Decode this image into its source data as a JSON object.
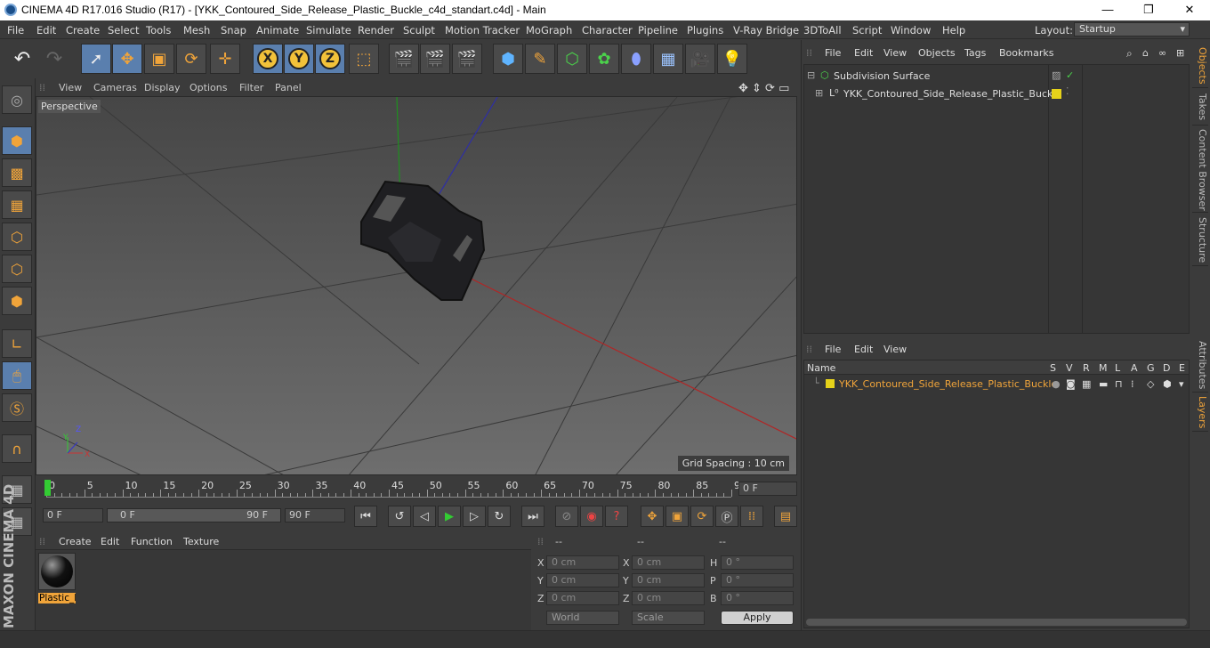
{
  "window": {
    "title": "CINEMA 4D R17.016 Studio (R17) - [YKK_Contoured_Side_Release_Plastic_Buckle_c4d_standart.c4d] - Main",
    "minimize": "—",
    "maximize": "❐",
    "close": "✕"
  },
  "menu": [
    "File",
    "Edit",
    "Create",
    "Select",
    "Tools",
    "Mesh",
    "Snap",
    "Animate",
    "Simulate",
    "Render",
    "Sculpt",
    "Motion Tracker",
    "MoGraph",
    "Character",
    "Pipeline",
    "Plugins",
    "V-Ray Bridge",
    "3DToAll",
    "Script",
    "Window",
    "Help"
  ],
  "layout": {
    "label": "Layout:",
    "value": "Startup"
  },
  "viewport": {
    "menu": [
      "View",
      "Cameras",
      "Display",
      "Options",
      "Filter",
      "Panel"
    ],
    "camera": "Perspective",
    "grid_spacing": "Grid Spacing : 10 cm"
  },
  "timeline": {
    "ticks": [
      "0",
      "5",
      "10",
      "15",
      "20",
      "25",
      "30",
      "35",
      "40",
      "45",
      "50",
      "55",
      "60",
      "65",
      "70",
      "75",
      "80",
      "85",
      "90"
    ],
    "current_frame": "0 F",
    "start": "0 F",
    "range_start": "0 F",
    "range_end": "90 F",
    "end": "90 F"
  },
  "material": {
    "menu": [
      "Create",
      "Edit",
      "Function",
      "Texture"
    ],
    "name": "Plastic_E"
  },
  "coords": {
    "header": [
      "--",
      "--",
      "--"
    ],
    "pos": [
      {
        "l": "X",
        "v": "0 cm"
      },
      {
        "l": "Y",
        "v": "0 cm"
      },
      {
        "l": "Z",
        "v": "0 cm"
      }
    ],
    "size": [
      {
        "l": "X",
        "v": "0 cm"
      },
      {
        "l": "Y",
        "v": "0 cm"
      },
      {
        "l": "Z",
        "v": "0 cm"
      }
    ],
    "rot": [
      {
        "l": "H",
        "v": "0 °"
      },
      {
        "l": "P",
        "v": "0 °"
      },
      {
        "l": "B",
        "v": "0 °"
      }
    ],
    "world": "World",
    "scale": "Scale",
    "apply": "Apply"
  },
  "objects": {
    "menu": [
      "File",
      "Edit",
      "View",
      "Objects",
      "Tags",
      "Bookmarks"
    ],
    "items": [
      {
        "name": "Subdivision Surface"
      },
      {
        "name": "YKK_Contoured_Side_Release_Plastic_Buckle"
      }
    ]
  },
  "layers": {
    "menu": [
      "File",
      "Edit",
      "View"
    ],
    "columns": [
      "Name",
      "S",
      "V",
      "R",
      "M",
      "L",
      "A",
      "G",
      "D",
      "E"
    ],
    "items": [
      {
        "name": "YKK_Contoured_Side_Release_Plastic_Buckle",
        "color": "#e6d21a"
      }
    ]
  },
  "sidetabs": [
    "Objects",
    "Takes",
    "Content Browser",
    "Structure",
    "Attributes",
    "Layers"
  ],
  "branding": {
    "maxon": "MAXON",
    "product": "CINEMA 4D"
  },
  "colors": {
    "accent": "#f0a43a",
    "active": "#5a7fae",
    "layer": "#e6d21a"
  }
}
